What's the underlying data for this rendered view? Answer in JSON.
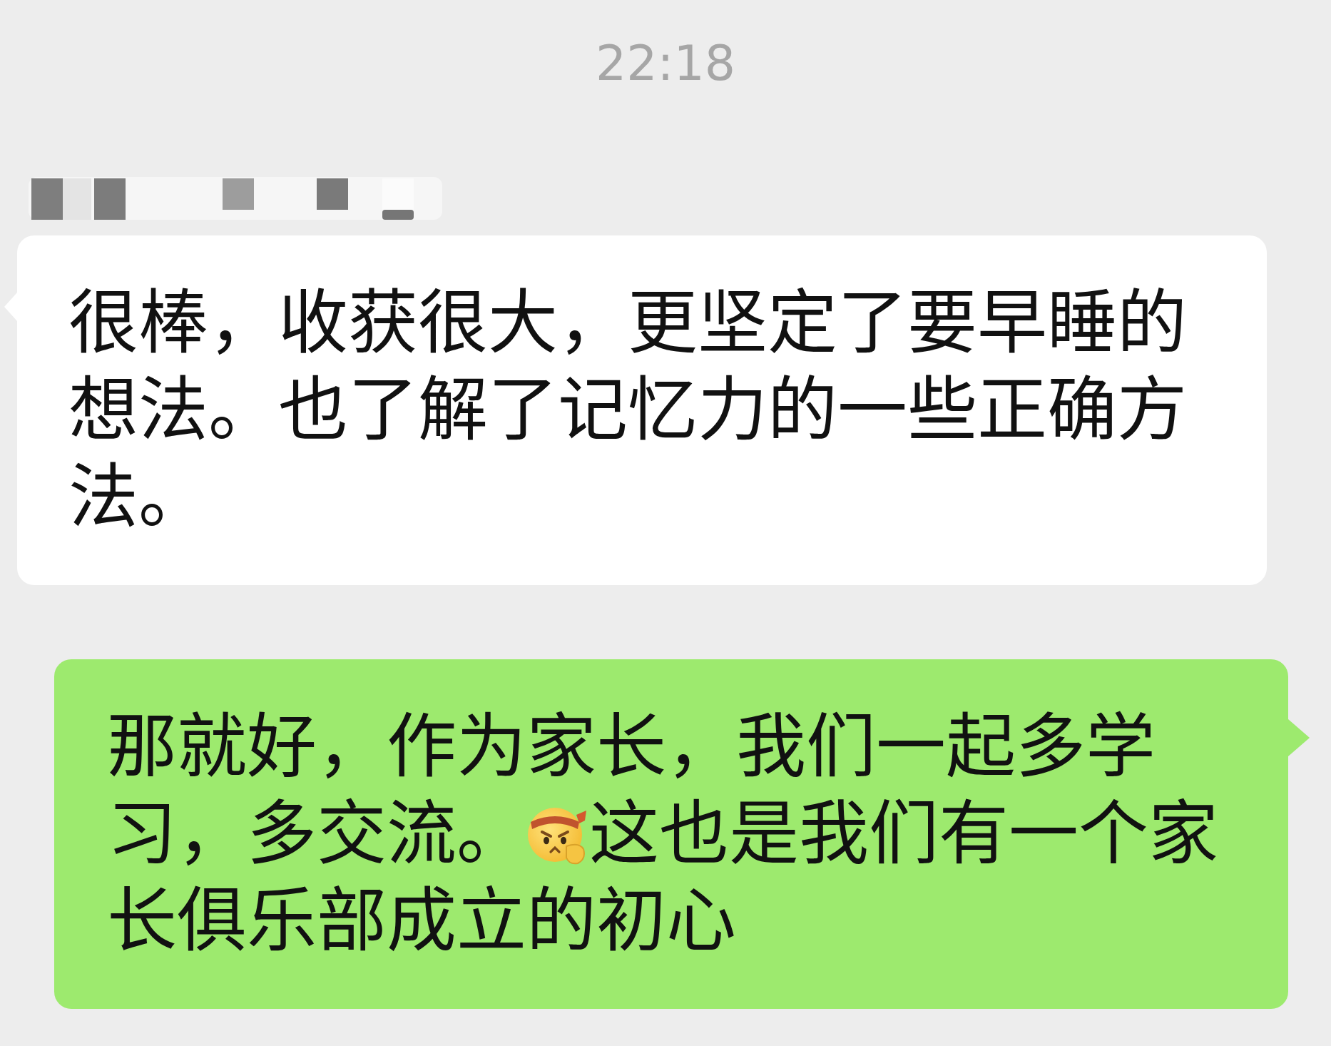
{
  "chat": {
    "timestamp": "22:18"
  },
  "messages": [
    {
      "kind": "incoming",
      "sender_name_obscured": true,
      "parts": [
        {
          "kind": "text",
          "text": "很棒，收获很大，更坚定了要早睡的想法。也了解了记忆力的一些正确方法。"
        }
      ]
    },
    {
      "kind": "outgoing",
      "parts": [
        {
          "kind": "text",
          "text": "那就好，作为家长，我们一起多学习，多交流。"
        },
        {
          "kind": "emoji"
        },
        {
          "kind": "text",
          "text": "这也是我们有一个家长俱乐部成立的初心"
        }
      ]
    }
  ]
}
